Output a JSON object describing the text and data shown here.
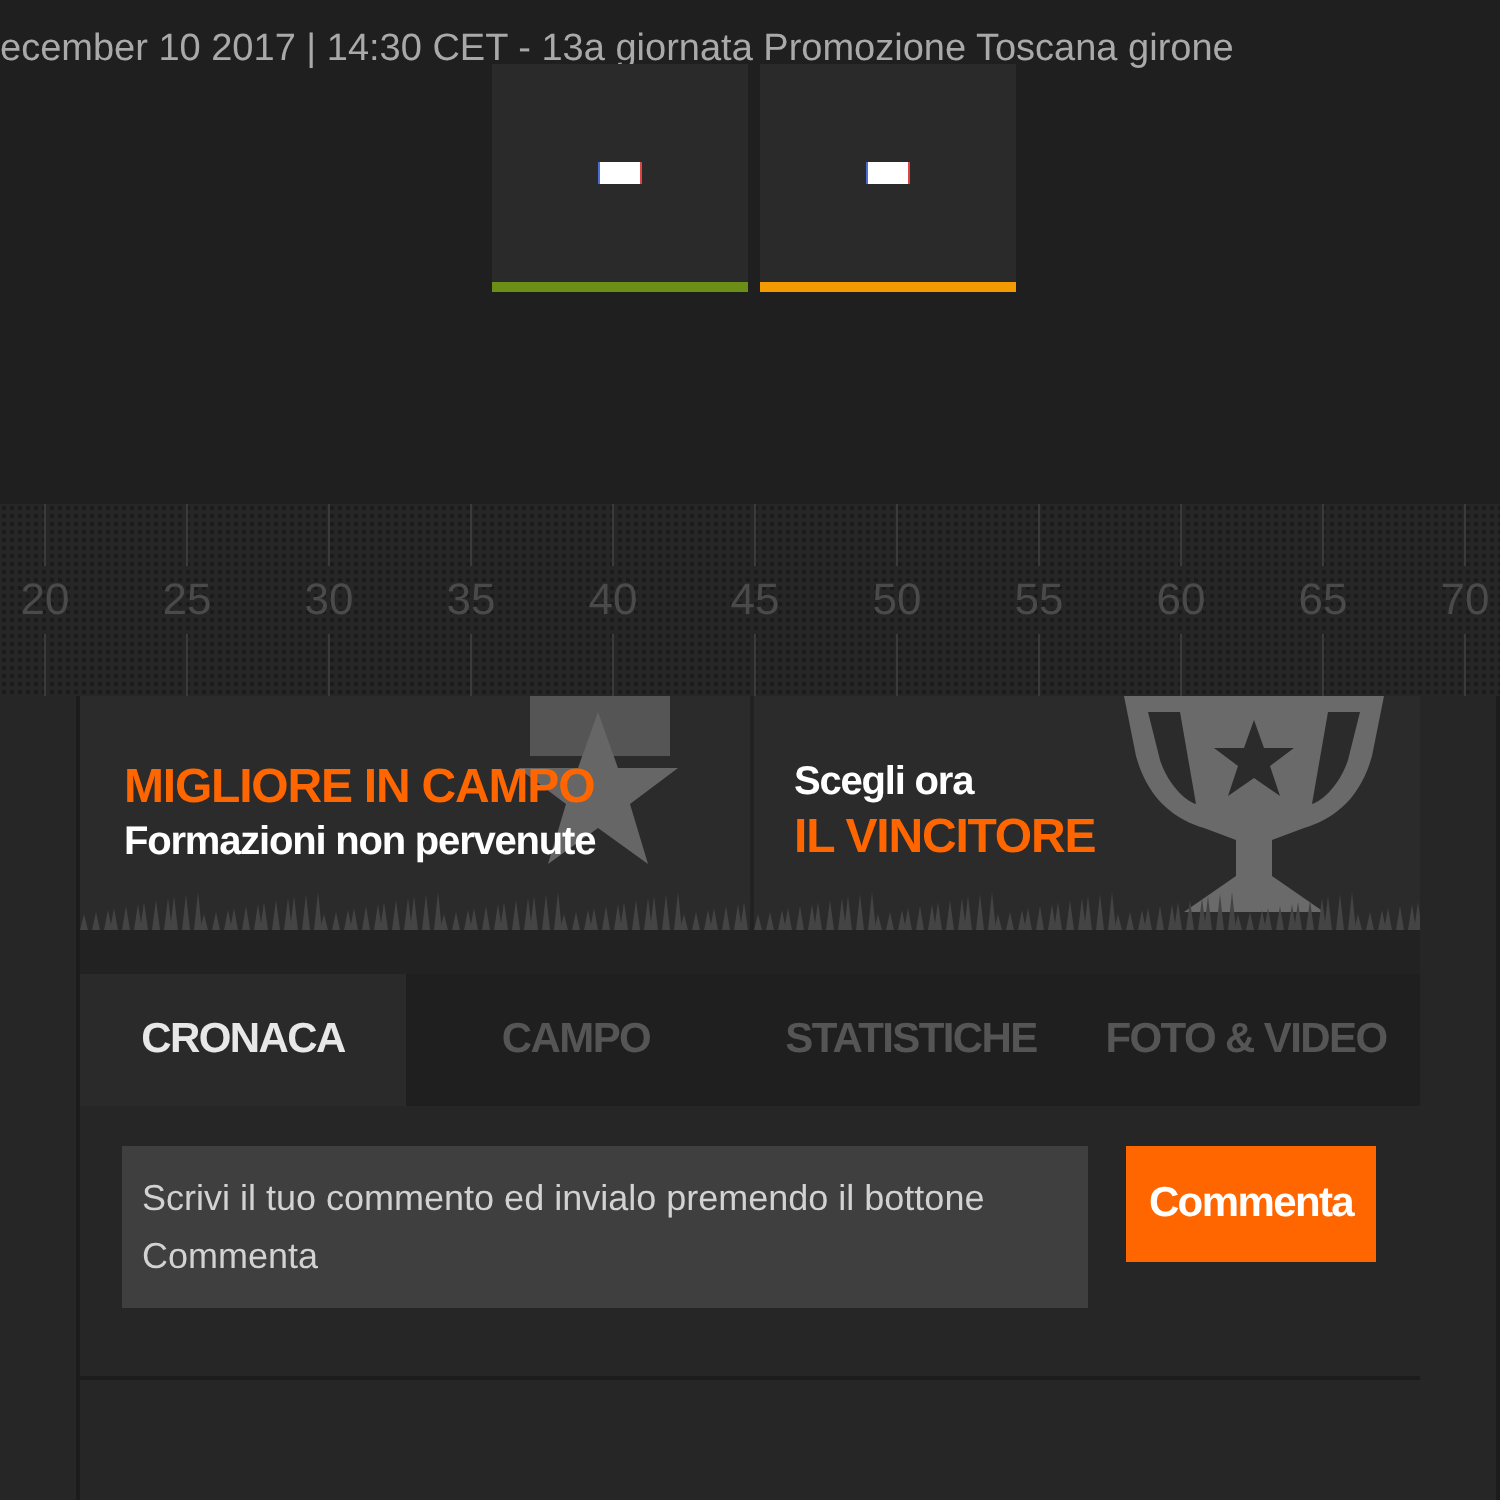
{
  "header": {
    "match_info": "ecember 10 2017 | 14:30 CET - 13a giornata Promozione Toscana girone"
  },
  "score_boxes": [
    {
      "color": "#6b8e16"
    },
    {
      "color": "#f39a00"
    }
  ],
  "timeline": {
    "ticks": [
      "20",
      "25",
      "30",
      "35",
      "40",
      "45",
      "50",
      "55",
      "60",
      "65",
      "70"
    ]
  },
  "banners": [
    {
      "kind": "player",
      "lines": [
        {
          "text": "MIGLIORE IN CAMPO",
          "accent": true
        },
        {
          "text": "Formazioni non pervenute",
          "accent": false
        }
      ]
    },
    {
      "kind": "winner",
      "lines": [
        {
          "text": "Scegli ora",
          "accent": false
        },
        {
          "text": "IL VINCITORE",
          "accent": true
        }
      ]
    }
  ],
  "tabs": [
    {
      "label": "CRONACA",
      "selected": true
    },
    {
      "label": "CAMPO",
      "selected": false
    },
    {
      "label": "STATISTICHE",
      "selected": false
    },
    {
      "label": "FOTO & VIDEO",
      "selected": false
    }
  ],
  "comment": {
    "placeholder": "Scrivi il tuo commento ed invialo premendo il bottone Commenta",
    "button": "Commenta"
  }
}
